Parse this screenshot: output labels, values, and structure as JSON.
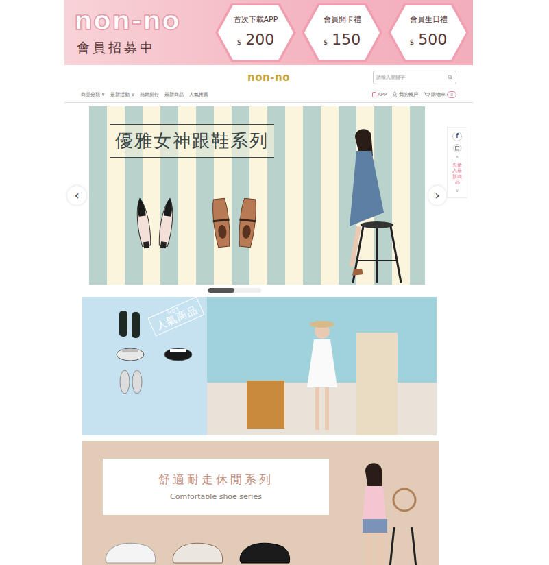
{
  "promo": {
    "logo": "non-no",
    "title": "會員招募中",
    "offers": [
      {
        "label": "首次下載APP",
        "currency": "$",
        "amount": "200"
      },
      {
        "label": "會員開卡禮",
        "currency": "$",
        "amount": "150"
      },
      {
        "label": "會員生日禮",
        "currency": "$",
        "amount": "500"
      }
    ]
  },
  "header": {
    "logo": "non-no",
    "search": {
      "placeholder": "請輸入關鍵字"
    },
    "caret": "∨",
    "nav": [
      {
        "label": "商品分類",
        "dropdown": true
      },
      {
        "label": "最新活動",
        "dropdown": true
      },
      {
        "label": "熱銷排行",
        "dropdown": false
      },
      {
        "label": "最新商品",
        "dropdown": false
      },
      {
        "label": "人氣推薦",
        "dropdown": false
      }
    ],
    "links": [
      {
        "label": "APP"
      },
      {
        "label": "我的帳戶"
      },
      {
        "label": "購物車",
        "badge": "0"
      }
    ]
  },
  "hero": {
    "title": "優雅女神跟鞋系列",
    "prev": "‹",
    "next": "›",
    "slides": [
      {
        "selected": true
      },
      {
        "selected": false
      }
    ]
  },
  "side_widget": {
    "facebook": "f",
    "up": "∧",
    "label": "先搶入最新商品",
    "down": "∨"
  },
  "hot": {
    "tag": "HOT",
    "stamp": "人氣商品"
  },
  "series": {
    "title": "舒適耐走休閒系列",
    "subtitle": "Comfortable shoe series"
  }
}
